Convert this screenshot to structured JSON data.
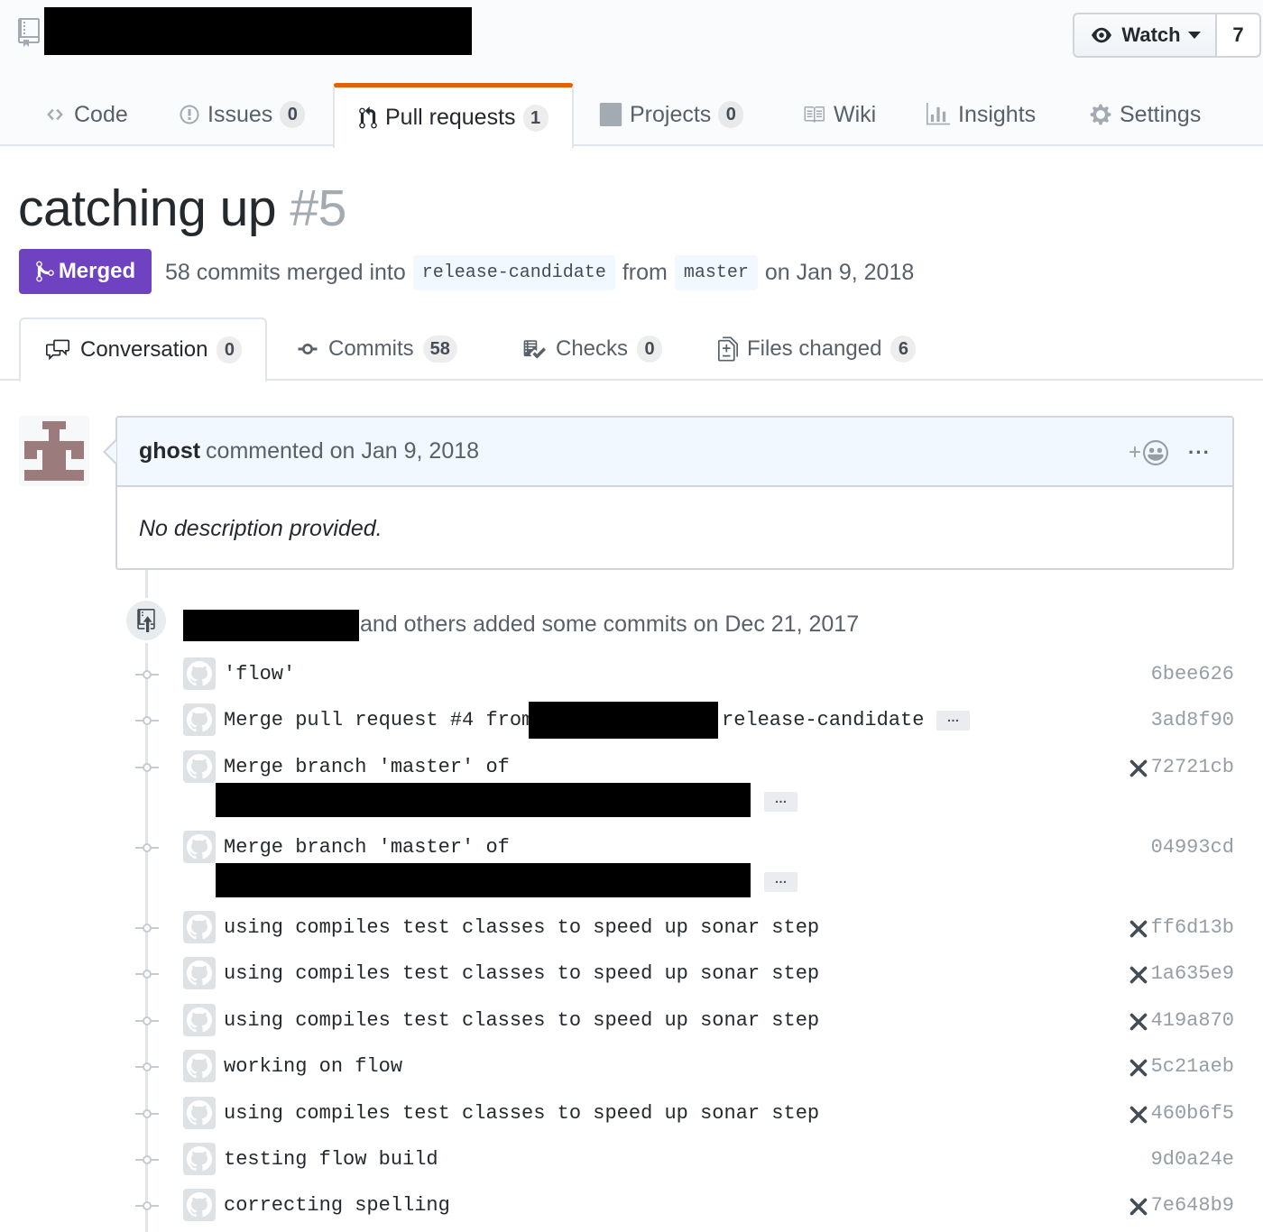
{
  "repo": {
    "watch_label": "Watch",
    "watch_count": "7"
  },
  "nav": {
    "code": "Code",
    "issues": "Issues",
    "issues_count": "0",
    "pulls": "Pull requests",
    "pulls_count": "1",
    "projects": "Projects",
    "projects_count": "0",
    "wiki": "Wiki",
    "insights": "Insights",
    "settings": "Settings"
  },
  "pr": {
    "title": "catching up",
    "number": "#5",
    "state": "Merged",
    "meta_prefix": "58 commits merged into",
    "base_branch": "release-candidate",
    "meta_from": "from",
    "head_branch": "master",
    "meta_date": "on Jan 9, 2018"
  },
  "tabs": {
    "conversation": "Conversation",
    "conversation_count": "0",
    "commits": "Commits",
    "commits_count": "58",
    "checks": "Checks",
    "checks_count": "0",
    "files": "Files changed",
    "files_count": "6"
  },
  "comment": {
    "author": "ghost",
    "action": "commented on Jan 9, 2018",
    "body": "No description provided."
  },
  "timeline": {
    "push_text": "and others added some commits on Dec 21, 2017"
  },
  "commits": [
    {
      "msg": "'flow'",
      "sha": "6bee626",
      "failed": false
    },
    {
      "msg": "Merge pull request #4 from",
      "msg_tail": "release-candidate",
      "sha": "3ad8f90",
      "failed": false
    },
    {
      "msg": "Merge branch 'master' of",
      "sha": "72721cb",
      "failed": true
    },
    {
      "msg": "Merge branch 'master' of",
      "sha": "04993cd",
      "failed": false
    },
    {
      "msg": "using compiles test classes to speed up sonar step",
      "sha": "ff6d13b",
      "failed": true
    },
    {
      "msg": "using compiles test classes to speed up sonar step",
      "sha": "1a635e9",
      "failed": true
    },
    {
      "msg": "using compiles test classes to speed up sonar step",
      "sha": "419a870",
      "failed": true
    },
    {
      "msg": "working on flow",
      "sha": "5c21aeb",
      "failed": true
    },
    {
      "msg": "using compiles test classes to speed up sonar step",
      "sha": "460b6f5",
      "failed": true
    },
    {
      "msg": "testing flow build",
      "sha": "9d0a24e",
      "failed": false
    },
    {
      "msg": "correcting spelling",
      "sha": "7e648b9",
      "failed": true
    }
  ],
  "ellipsis": "…",
  "colors": {
    "merged": "#6f42c1",
    "nav_selected_border": "#e36209",
    "sha": "#959da5"
  }
}
